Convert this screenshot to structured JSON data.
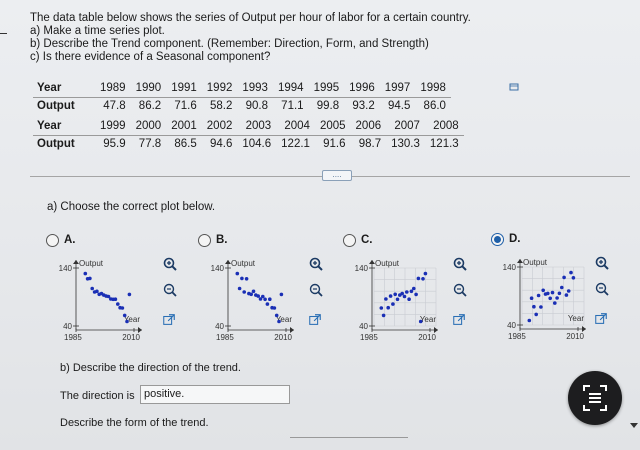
{
  "intro": {
    "line1": "The data table below shows the series of Output per hour of labor for a certain country.",
    "line2": "a) Make a time series plot.",
    "line3": "b) Describe the Trend component. (Remember: Direction, Form, and Strength)",
    "line4": "c) Is there evidence of a Seasonal component?"
  },
  "table": {
    "row_year_label": "Year",
    "row_output_label": "Output",
    "block1_years": [
      "1989",
      "1990",
      "1991",
      "1992",
      "1993",
      "1994",
      "1995",
      "1996",
      "1997",
      "1998"
    ],
    "block1_output": [
      "47.8",
      "86.2",
      "71.6",
      "58.2",
      "90.8",
      "71.1",
      "99.8",
      "93.2",
      "94.5",
      "86.0"
    ],
    "block2_years": [
      "1999",
      "2000",
      "2001",
      "2002",
      "2003",
      "2004",
      "2005",
      "2006",
      "2007",
      "2008"
    ],
    "block2_output": [
      "95.9",
      "77.8",
      "86.5",
      "94.6",
      "104.6",
      "122.1",
      "91.6",
      "98.7",
      "130.3",
      "121.3"
    ]
  },
  "more_button": "....",
  "part_a": {
    "prompt": "a) Choose the correct plot below.",
    "options": [
      {
        "letter": "A.",
        "selected": false
      },
      {
        "letter": "B.",
        "selected": false
      },
      {
        "letter": "C.",
        "selected": false
      },
      {
        "letter": "D.",
        "selected": true
      }
    ],
    "plot_labels": {
      "y_axis": "Output",
      "x_axis": "Year",
      "y_top": "140",
      "y_bottom": "40",
      "x_left": "1985",
      "x_right": "2010"
    }
  },
  "part_b": {
    "prompt": "b) Describe the direction of the trend.",
    "direction_label": "The direction is",
    "direction_value": "positive.",
    "form_prompt": "Describe the form of the trend."
  },
  "colors": {
    "accent": "#1f5fa8",
    "dots": "#1a2fb5"
  },
  "icons": [
    "zoom-in-icon",
    "zoom-out-icon",
    "expand-icon",
    "keyboard-icon"
  ],
  "chart_data": [
    {
      "type": "scatter",
      "option": "A",
      "xlabel": "Year",
      "ylabel": "Output",
      "xlim": [
        1985,
        2010
      ],
      "ylim": [
        40,
        140
      ],
      "x": [
        1989,
        1990,
        1991,
        1992,
        1993,
        1994,
        1995,
        1996,
        1997,
        1998,
        1999,
        2000,
        2001,
        2002,
        2003,
        2004,
        2005,
        2006,
        2007,
        2008
      ],
      "values": [
        130.3,
        121.3,
        122.1,
        104.6,
        98.7,
        99.8,
        94.6,
        95.9,
        93.2,
        91.6,
        90.8,
        86.5,
        86.0,
        86.2,
        77.8,
        71.6,
        71.1,
        58.2,
        47.8,
        94.5
      ]
    },
    {
      "type": "scatter",
      "option": "B",
      "xlabel": "Year",
      "ylabel": "Output",
      "xlim": [
        1985,
        2010
      ],
      "ylim": [
        40,
        140
      ],
      "x": [
        1989,
        1990,
        1991,
        1992,
        1993,
        1994,
        1995,
        1996,
        1997,
        1998,
        1999,
        2000,
        2001,
        2002,
        2003,
        2004,
        2005,
        2006,
        2007,
        2008
      ],
      "values": [
        130.3,
        104.6,
        122.1,
        98.7,
        121.3,
        95.9,
        94.6,
        99.8,
        93.2,
        91.6,
        86.5,
        90.8,
        86.0,
        77.8,
        86.2,
        71.6,
        71.1,
        58.2,
        47.8,
        94.5
      ]
    },
    {
      "type": "scatter",
      "option": "C",
      "xlabel": "Year",
      "ylabel": "Output",
      "xlim": [
        1985,
        2010
      ],
      "ylim": [
        40,
        140
      ],
      "x": [
        1989,
        1990,
        1991,
        1992,
        1993,
        1994,
        1995,
        1996,
        1997,
        1998,
        1999,
        2000,
        2001,
        2002,
        2003,
        2004,
        2005,
        2006,
        2007,
        2008
      ],
      "values": [
        71.1,
        58.2,
        86.5,
        71.6,
        91.6,
        77.8,
        94.6,
        86.0,
        93.2,
        95.9,
        90.8,
        98.7,
        86.2,
        99.8,
        104.6,
        94.5,
        122.1,
        47.8,
        121.3,
        130.3
      ]
    },
    {
      "type": "scatter",
      "option": "D",
      "xlabel": "Year",
      "ylabel": "Output",
      "xlim": [
        1985,
        2010
      ],
      "ylim": [
        40,
        140
      ],
      "x": [
        1989,
        1990,
        1991,
        1992,
        1993,
        1994,
        1995,
        1996,
        1997,
        1998,
        1999,
        2000,
        2001,
        2002,
        2003,
        2004,
        2005,
        2006,
        2007,
        2008
      ],
      "values": [
        47.8,
        86.2,
        71.6,
        58.2,
        90.8,
        71.1,
        99.8,
        93.2,
        94.5,
        86.0,
        95.9,
        77.8,
        86.5,
        94.6,
        104.6,
        122.1,
        91.6,
        98.7,
        130.3,
        121.3
      ]
    }
  ]
}
